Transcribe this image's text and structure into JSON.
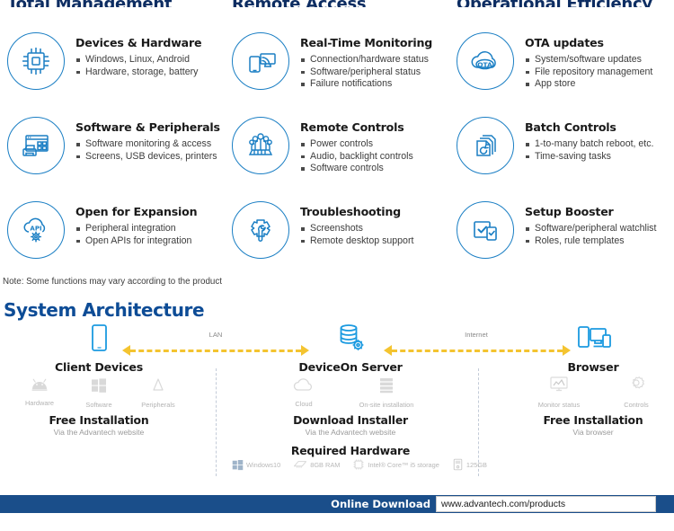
{
  "columns": [
    {
      "heading": "Total Management"
    },
    {
      "heading": "Remote Access"
    },
    {
      "heading": "Operational Efficiency"
    }
  ],
  "features": [
    {
      "icon": "chip-icon",
      "title": "Devices & Hardware",
      "bullets": [
        "Windows, Linux, Android",
        "Hardware, storage, battery"
      ]
    },
    {
      "icon": "realtime-monitor-icon",
      "title": "Real-Time Monitoring",
      "bullets": [
        "Connection/hardware status",
        "Software/peripheral status",
        "Failure notifications"
      ]
    },
    {
      "icon": "ota-cloud-icon",
      "title": "OTA updates",
      "bullets": [
        "System/software updates",
        "File repository management",
        "App store"
      ]
    },
    {
      "icon": "software-peripherals-icon",
      "title": "Software & Peripherals",
      "bullets": [
        "Software monitoring & access",
        "Screens, USB devices, printers"
      ]
    },
    {
      "icon": "remote-controls-icon",
      "title": "Remote Controls",
      "bullets": [
        "Power controls",
        "Audio, backlight controls",
        "Software controls"
      ]
    },
    {
      "icon": "batch-controls-icon",
      "title": "Batch Controls",
      "bullets": [
        "1-to-many batch reboot, etc.",
        "Time-saving tasks"
      ]
    },
    {
      "icon": "api-cloud-gear-icon",
      "title": "Open for Expansion",
      "bullets": [
        "Peripheral integration",
        "Open APIs for integration"
      ]
    },
    {
      "icon": "troubleshooting-gear-wrench-icon",
      "title": "Troubleshooting",
      "bullets": [
        "Screenshots",
        "Remote desktop support"
      ]
    },
    {
      "icon": "setup-booster-icon",
      "title": "Setup Booster",
      "bullets": [
        "Software/peripheral watchlist",
        "Roles, rule templates"
      ]
    }
  ],
  "note": "Note: Some functions may vary according to the product",
  "architecture": {
    "section_title": "System Architecture",
    "nodes": {
      "client": {
        "icon": "tablet-icon",
        "label": "Client Devices",
        "subicons": [
          {
            "icon": "android-icon",
            "label": "Hardware"
          },
          {
            "icon": "windows-icon",
            "label": "Software"
          },
          {
            "icon": "linux-tux-icon",
            "label": "Peripherals"
          }
        ],
        "block_heading": "Free Installation",
        "block_sub": "Via the Advantech website"
      },
      "server": {
        "icon": "database-gear-icon",
        "label": "DeviceOn Server",
        "subicons": [
          {
            "icon": "cloud-icon",
            "label": "Cloud"
          },
          {
            "icon": "server-rack-icon",
            "label": "On-site installation"
          }
        ],
        "block_heading": "Download Installer",
        "block_sub": "Via the Advantech website",
        "hardware_heading": "Required Hardware",
        "hardware": [
          {
            "icon": "windows-icon",
            "label": "Windows10"
          },
          {
            "icon": "ram-stick-icon",
            "label": "8GB RAM"
          },
          {
            "icon": "cpu-icon",
            "label": "Intel® Core™ i5 storage"
          },
          {
            "icon": "hdd-icon",
            "label": "125GB"
          }
        ]
      },
      "browser": {
        "icon": "multi-device-icon",
        "label": "Browser",
        "subicons": [
          {
            "icon": "monitor-status-icon",
            "label": "Monitor status"
          },
          {
            "icon": "controls-gear-icon",
            "label": "Controls"
          }
        ],
        "block_heading": "Free Installation",
        "block_sub": "Via browser"
      }
    },
    "connections": [
      {
        "label": "LAN"
      },
      {
        "label": "Internet"
      }
    ]
  },
  "footer": {
    "title": "Online Download",
    "url": "www.advantech.com/products"
  },
  "colors": {
    "brand_blue": "#1b7fc4",
    "heading_navy": "#0d2d62",
    "section_blue": "#0d4c96",
    "arrow_yellow": "#f4c430",
    "footer_bar": "#1a4e8a"
  }
}
